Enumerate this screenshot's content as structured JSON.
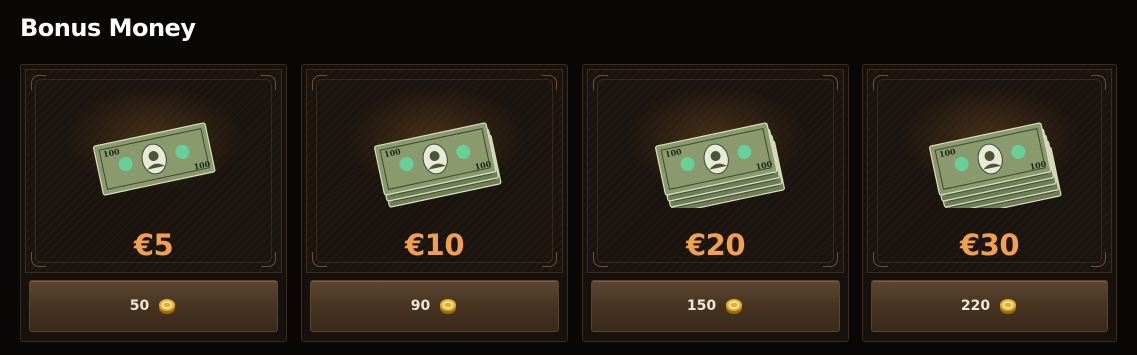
{
  "section": {
    "title": "Bonus Money"
  },
  "colors": {
    "amount": "#f0a050",
    "background": "#0a0806",
    "card": "#1b140e",
    "button": "#4a3724",
    "coin": "#e3a72f"
  },
  "currency_icon": "gold-coin-icon",
  "cards": [
    {
      "amount": "€5",
      "price": "50",
      "bill_stack_count": 1,
      "bill_denomination": "100"
    },
    {
      "amount": "€10",
      "price": "90",
      "bill_stack_count": 3,
      "bill_denomination": "100"
    },
    {
      "amount": "€20",
      "price": "150",
      "bill_stack_count": 4,
      "bill_denomination": "100"
    },
    {
      "amount": "€30",
      "price": "220",
      "bill_stack_count": 5,
      "bill_denomination": "100"
    }
  ]
}
